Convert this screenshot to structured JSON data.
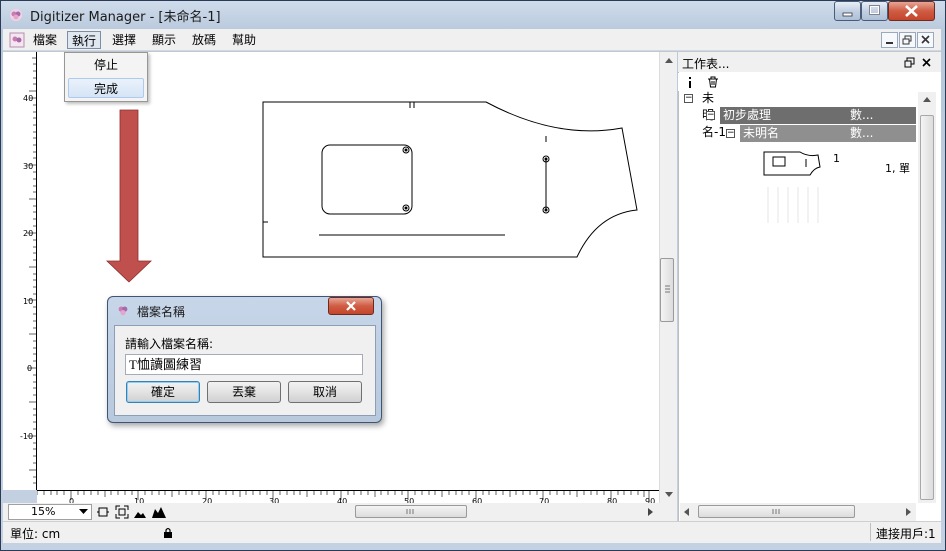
{
  "window": {
    "title": "Digitizer Manager - [未命名-1]",
    "accent": "#c9d7e8"
  },
  "menubar": {
    "items": [
      {
        "label": "檔案"
      },
      {
        "label": "執行"
      },
      {
        "label": "選擇"
      },
      {
        "label": "顯示"
      },
      {
        "label": "放碼"
      },
      {
        "label": "幫助"
      }
    ]
  },
  "exec_menu": {
    "items": [
      {
        "label": "停止"
      },
      {
        "label": "完成"
      }
    ]
  },
  "rulers": {
    "vertical_labels": [
      "40",
      "30",
      "20",
      "10",
      "0",
      "-10"
    ],
    "horizontal_labels": [
      "0",
      "10",
      "20",
      "30",
      "40",
      "50",
      "60",
      "70",
      "80",
      "90"
    ]
  },
  "toolbar": {
    "zoom": "15%"
  },
  "statusbar": {
    "unit": "單位: cm",
    "connection": "連接用戶:1"
  },
  "panel": {
    "title": "工作表...",
    "tree": {
      "root": "未明名-1",
      "group": {
        "label": "初步處理",
        "value": "數..."
      },
      "child": {
        "label": "未明名",
        "value": "數..."
      },
      "piece_number": "1",
      "piece_extra": "1, 單"
    }
  },
  "dialog": {
    "title": "檔案名稱",
    "prompt": "請輸入檔案名稱:",
    "input_value": "T恤讀圖練習",
    "buttons": {
      "ok": "確定",
      "discard": "丟棄",
      "cancel": "取消"
    }
  },
  "colors": {
    "arrow": "#c0504d",
    "tree_group_bg": "#6e6e6e",
    "tree_child_bg": "#8f8f8f"
  }
}
